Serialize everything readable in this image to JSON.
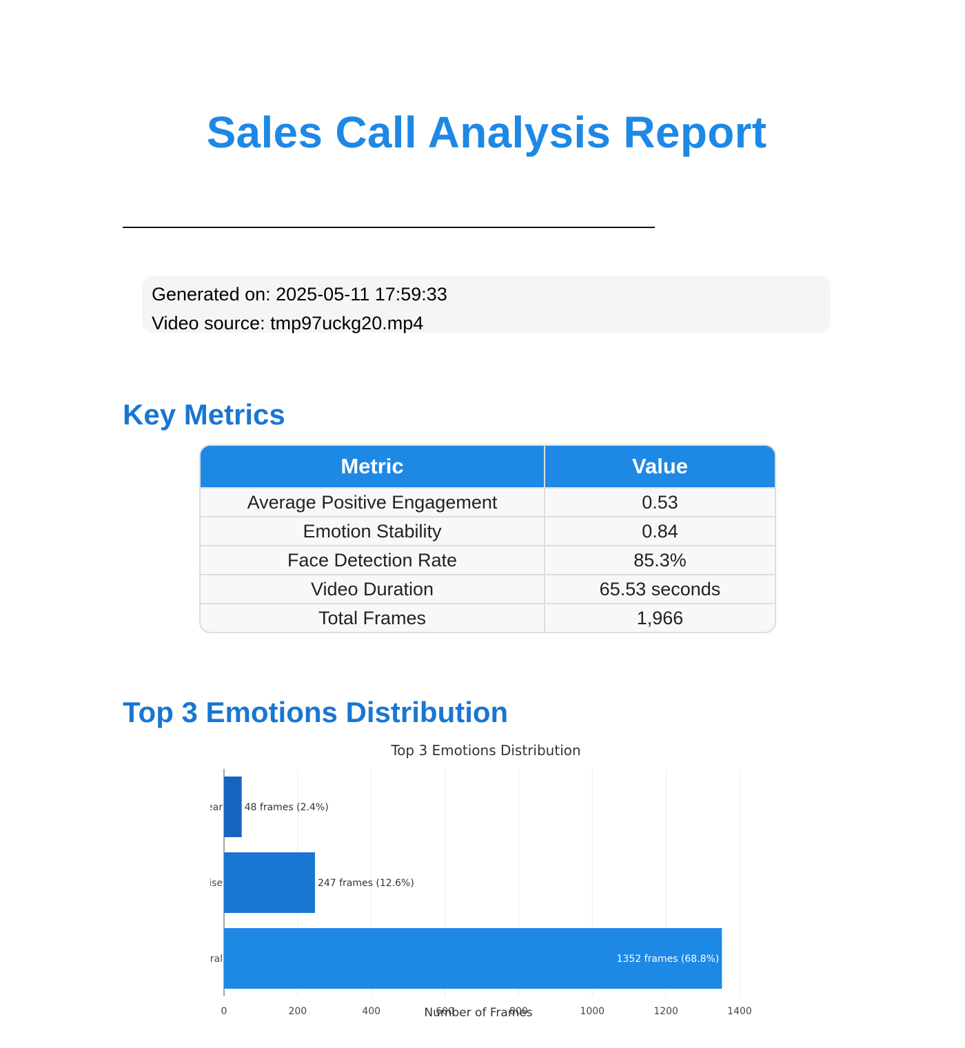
{
  "report": {
    "title": "Sales Call Analysis Report",
    "generated_on": "Generated on: 2025-05-11 17:59:33",
    "video_source": "Video source: tmp97uckg20.mp4"
  },
  "key_metrics": {
    "heading": "Key Metrics",
    "columns": [
      "Metric",
      "Value"
    ],
    "rows": [
      {
        "metric": "Average Positive Engagement",
        "value": "0.53"
      },
      {
        "metric": "Emotion Stability",
        "value": "0.84"
      },
      {
        "metric": "Face Detection Rate",
        "value": "85.3%"
      },
      {
        "metric": "Video Duration",
        "value": "65.53 seconds"
      },
      {
        "metric": "Total Frames",
        "value": "1,966"
      }
    ]
  },
  "emotions_section": {
    "heading": "Top 3 Emotions Distribution"
  },
  "chart_data": {
    "type": "bar",
    "orientation": "horizontal",
    "title": "Top 3 Emotions Distribution",
    "xlabel": "Number of Frames",
    "ylabel": "",
    "xlim": [
      0,
      1400
    ],
    "xticks": [
      0,
      200,
      400,
      600,
      800,
      1000,
      1200,
      1400
    ],
    "categories": [
      "ear",
      "ise",
      "ral"
    ],
    "values": [
      48,
      247,
      1352
    ],
    "data_labels": [
      "48 frames (2.4%)",
      "247 frames (12.6%)",
      "1352 frames (68.8%)"
    ],
    "bar_colors": [
      "#1565c0",
      "#1976d2",
      "#1e88e5"
    ],
    "grid": true,
    "legend": "none"
  }
}
